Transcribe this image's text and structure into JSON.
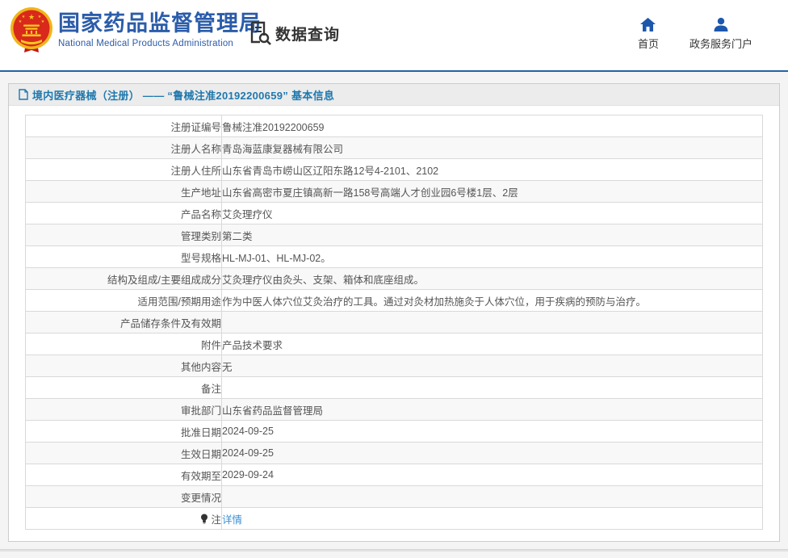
{
  "header": {
    "brand_title": "国家药品监督管理局",
    "brand_subtitle": "National Medical Products Administration",
    "data_query_label": "数据查询",
    "nav_home_label": "首页",
    "nav_portal_label": "政务服务门户"
  },
  "page_title": "境内医疗器械（注册） —— “鲁械注准20192200659” 基本信息",
  "table": {
    "rows": [
      {
        "label": "注册证编号",
        "value": "鲁械注准20192200659"
      },
      {
        "label": "注册人名称",
        "value": "青岛海蓝康复器械有限公司"
      },
      {
        "label": "注册人住所",
        "value": "山东省青岛市崂山区辽阳东路12号4-2101、2102"
      },
      {
        "label": "生产地址",
        "value": "山东省高密市夏庄镇高新一路158号高端人才创业园6号楼1层、2层"
      },
      {
        "label": "产品名称",
        "value": "艾灸理疗仪"
      },
      {
        "label": "管理类别",
        "value": "第二类"
      },
      {
        "label": "型号规格",
        "value": "HL-MJ-01、HL-MJ-02。"
      },
      {
        "label": "结构及组成/主要组成成分",
        "value": "艾灸理疗仪由灸头、支架、箱体和底座组成。"
      },
      {
        "label": "适用范围/预期用途",
        "value": "作为中医人体穴位艾灸治疗的工具。通过对灸材加热施灸于人体穴位，用于疾病的预防与治疗。"
      },
      {
        "label": "产品储存条件及有效期",
        "value": ""
      },
      {
        "label": "附件",
        "value": "产品技术要求"
      },
      {
        "label": "其他内容",
        "value": "无"
      },
      {
        "label": "备注",
        "value": ""
      },
      {
        "label": "审批部门",
        "value": "山东省药品监督管理局"
      },
      {
        "label": "批准日期",
        "value": "2024-09-25"
      },
      {
        "label": "生效日期",
        "value": "2024-09-25"
      },
      {
        "label": "有效期至",
        "value": "2029-09-24"
      },
      {
        "label": "变更情况",
        "value": ""
      },
      {
        "label": "注",
        "value": "详情",
        "link": true,
        "label_icon": "bulb-icon"
      }
    ]
  },
  "colors": {
    "brand_blue": "#2b5caa",
    "icon_blue": "#1d57ad",
    "divider_blue": "#2263a8",
    "title_blue": "#1e78ae",
    "link_blue": "#3a8fd4",
    "emblem_red": "#d9291c",
    "emblem_gold": "#f0b519"
  }
}
